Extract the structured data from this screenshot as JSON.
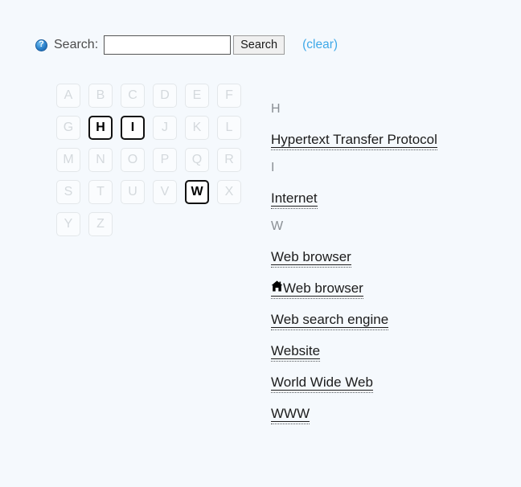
{
  "search": {
    "help_icon": "help-question-icon",
    "label": "Search:",
    "input_value": "",
    "input_placeholder": "",
    "button_label": "Search",
    "clear_label": "(clear)",
    "clear_color": "#3fa9e8"
  },
  "alphabet": {
    "letters": [
      {
        "label": "A",
        "active": false
      },
      {
        "label": "B",
        "active": false
      },
      {
        "label": "C",
        "active": false
      },
      {
        "label": "D",
        "active": false
      },
      {
        "label": "E",
        "active": false
      },
      {
        "label": "F",
        "active": false
      },
      {
        "label": "G",
        "active": false
      },
      {
        "label": "H",
        "active": true
      },
      {
        "label": "I",
        "active": true
      },
      {
        "label": "J",
        "active": false
      },
      {
        "label": "K",
        "active": false
      },
      {
        "label": "L",
        "active": false
      },
      {
        "label": "M",
        "active": false
      },
      {
        "label": "N",
        "active": false
      },
      {
        "label": "O",
        "active": false
      },
      {
        "label": "P",
        "active": false
      },
      {
        "label": "Q",
        "active": false
      },
      {
        "label": "R",
        "active": false
      },
      {
        "label": "S",
        "active": false
      },
      {
        "label": "T",
        "active": false
      },
      {
        "label": "U",
        "active": false
      },
      {
        "label": "V",
        "active": false
      },
      {
        "label": "W",
        "active": true
      },
      {
        "label": "X",
        "active": false
      },
      {
        "label": "Y",
        "active": false
      },
      {
        "label": "Z",
        "active": false
      }
    ],
    "active_letters": [
      "H",
      "I",
      "W"
    ],
    "disabled_color": "#d4d9dd",
    "active_color": "#000000"
  },
  "index": {
    "sections": [
      {
        "heading": "H",
        "entries": [
          {
            "label": "Hypertext Transfer Protocol",
            "icon": null
          }
        ]
      },
      {
        "heading": "I",
        "entries": [
          {
            "label": "Internet",
            "icon": null
          }
        ]
      },
      {
        "heading": "W",
        "entries": [
          {
            "label": "Web browser",
            "icon": null
          },
          {
            "label": "Web browser",
            "icon": "home-icon"
          },
          {
            "label": "Web search engine",
            "icon": null
          },
          {
            "label": "Website",
            "icon": null
          },
          {
            "label": "World Wide Web",
            "icon": null
          },
          {
            "label": "WWW",
            "icon": null
          }
        ]
      }
    ]
  },
  "theme": {
    "background": "#f5f9fd",
    "text": "#1c1c1c",
    "heading": "#8a8f94"
  }
}
